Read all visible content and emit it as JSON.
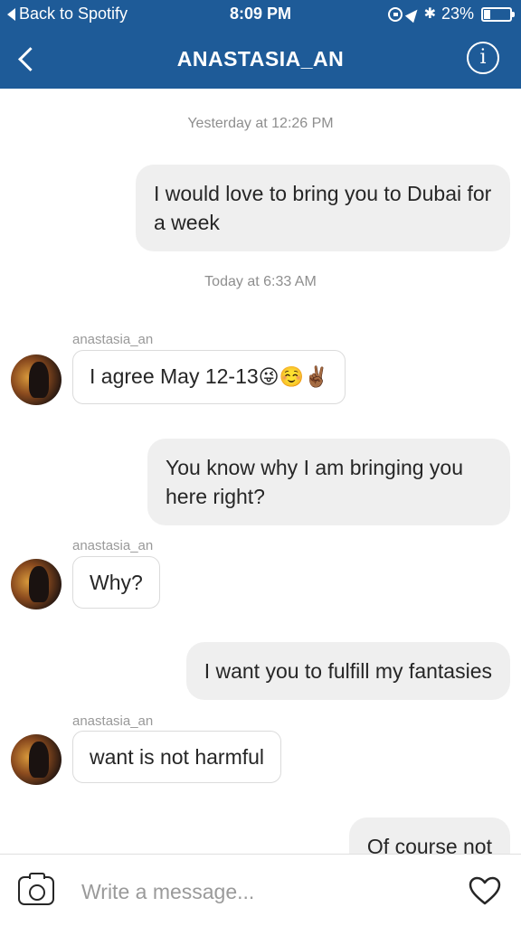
{
  "status_bar": {
    "back_app": "Back to Spotify",
    "time": "8:09 PM",
    "battery": "23%"
  },
  "header": {
    "title": "ANASTASIA_AN",
    "info_icon": "info-icon",
    "back_icon": "chevron-left-icon"
  },
  "thread": {
    "timestamp_1": "Yesterday at 12:26 PM",
    "msg_1": "I would love to bring you to Dubai for a week",
    "timestamp_2": "Today at 6:33 AM",
    "sender_1": "anastasia_an",
    "msg_2_text": "I agree May 12-13",
    "msg_2_emoji": "😜☺️✌🏾",
    "msg_3": "You know why I am bringing you here right?",
    "sender_2": "anastasia_an",
    "msg_4": "Why?",
    "msg_5": "I want you to fulfill my fantasies",
    "sender_3": "anastasia_an",
    "msg_6": "want is not harmful",
    "msg_7": "Of course not"
  },
  "composer": {
    "placeholder": "Write a message...",
    "camera_icon": "camera-icon",
    "heart_icon": "heart-icon"
  }
}
